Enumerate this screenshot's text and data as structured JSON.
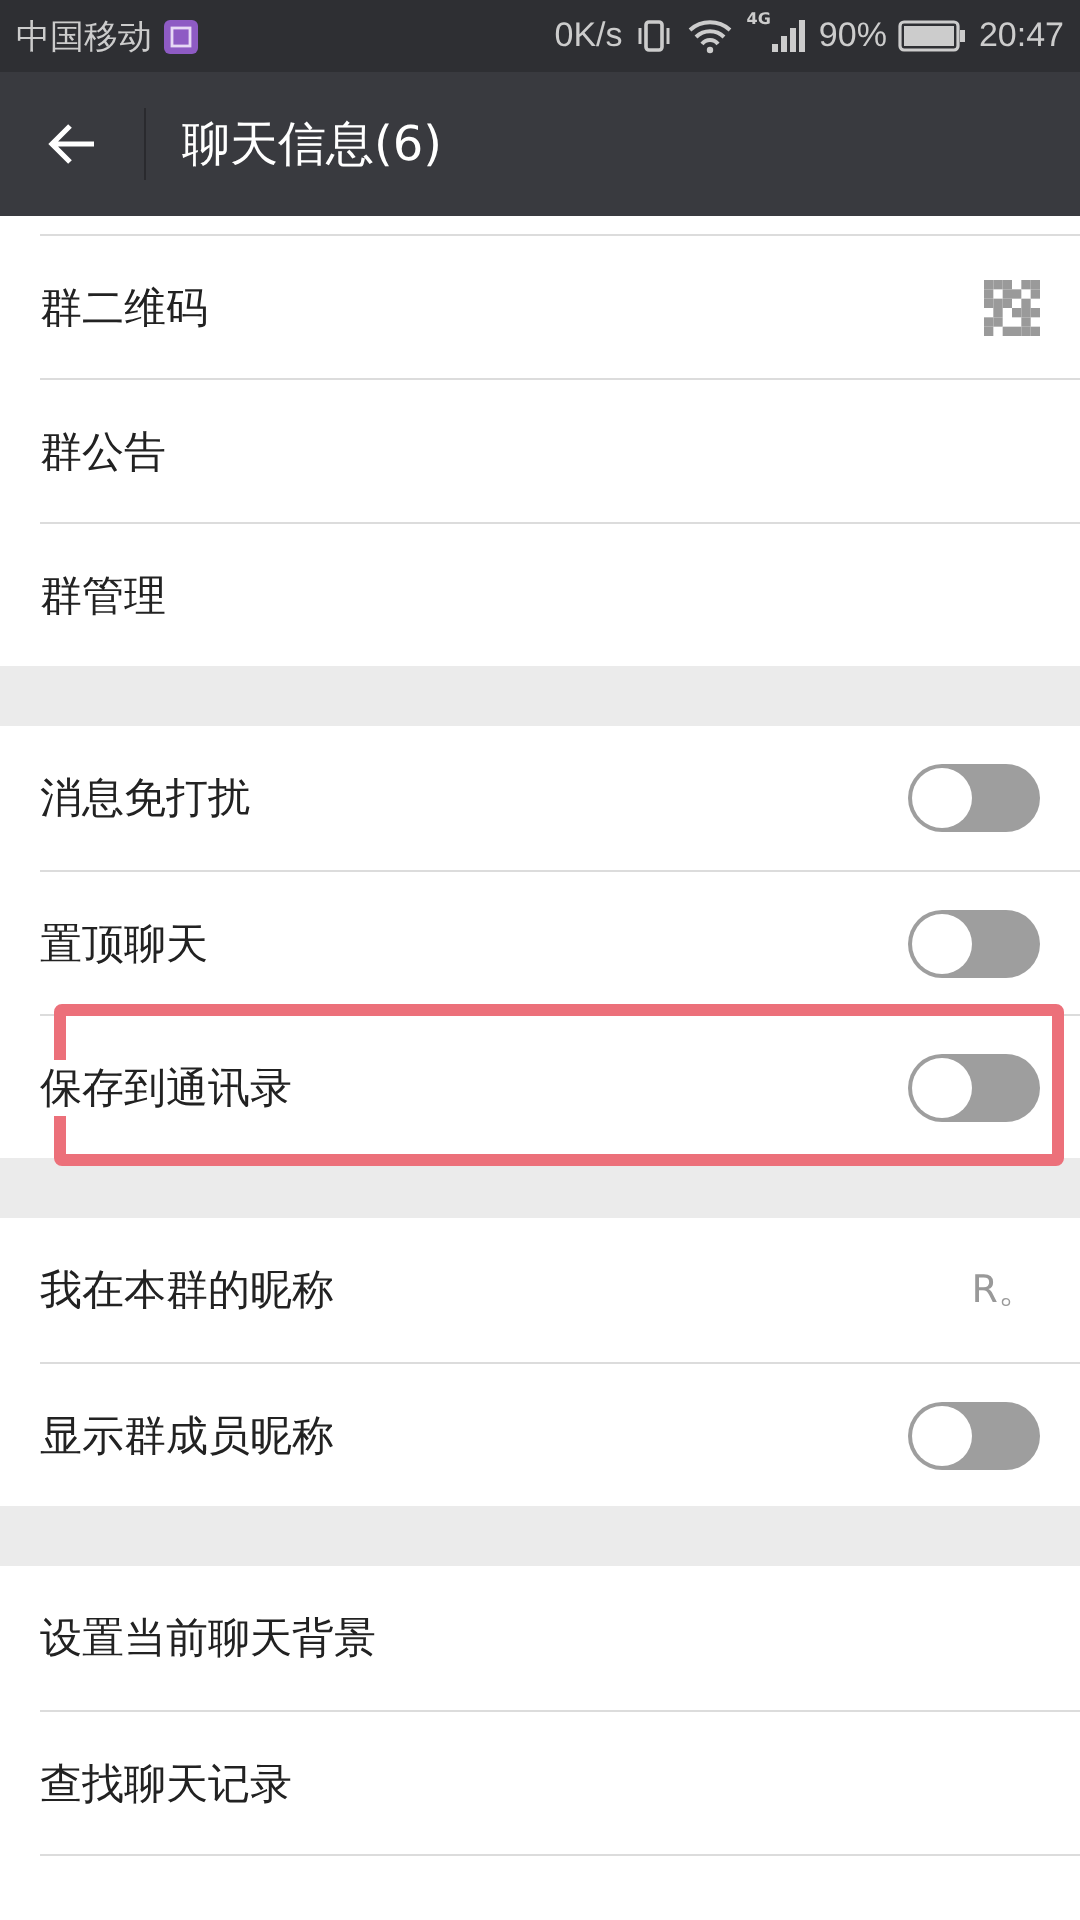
{
  "status_bar": {
    "carrier": "中国移动",
    "speed": "0K/s",
    "network": "4G",
    "battery": "90%",
    "time": "20:47"
  },
  "app_bar": {
    "title": "聊天信息(6)"
  },
  "sections": [
    {
      "items": [
        {
          "kind": "qr",
          "label": "群二维码"
        },
        {
          "kind": "link",
          "label": "群公告"
        },
        {
          "kind": "link",
          "label": "群管理"
        }
      ]
    },
    {
      "items": [
        {
          "kind": "toggle",
          "label": "消息免打扰",
          "on": false,
          "highlighted": false
        },
        {
          "kind": "toggle",
          "label": "置顶聊天",
          "on": false,
          "highlighted": false
        },
        {
          "kind": "toggle",
          "label": "保存到通讯录",
          "on": false,
          "highlighted": true
        }
      ]
    },
    {
      "items": [
        {
          "kind": "value",
          "label": "我在本群的昵称",
          "value": "R。"
        },
        {
          "kind": "toggle",
          "label": "显示群成员昵称",
          "on": false,
          "highlighted": false
        }
      ]
    },
    {
      "items": [
        {
          "kind": "link",
          "label": "设置当前聊天背景"
        },
        {
          "kind": "link",
          "label": "查找聊天记录"
        }
      ]
    }
  ]
}
